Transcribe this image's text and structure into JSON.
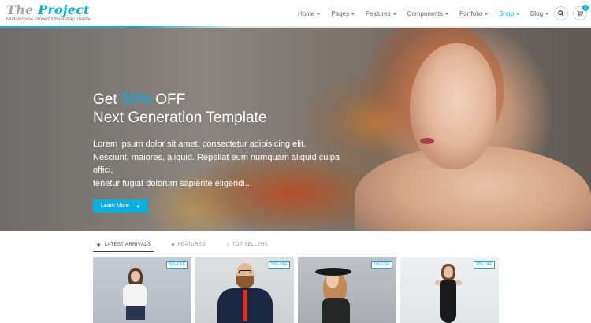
{
  "brand": {
    "logo_part1": "The",
    "logo_part2": "Project",
    "tagline": "Multipurpose Powerful Bootstrap Theme"
  },
  "nav": {
    "items": [
      {
        "label": "Home",
        "active": false
      },
      {
        "label": "Pages",
        "active": false
      },
      {
        "label": "Features",
        "active": false
      },
      {
        "label": "Components",
        "active": false
      },
      {
        "label": "Portfolio",
        "active": false
      },
      {
        "label": "Shop",
        "active": true
      },
      {
        "label": "Blog",
        "active": false
      }
    ],
    "search_icon": "search-icon",
    "cart_icon": "cart-icon",
    "cart_count": "0"
  },
  "hero": {
    "title_prefix": "Get",
    "title_accent": "50%",
    "title_suffix": "OFF",
    "title_line2": "Next Generation Template",
    "text_line1": "Lorem ipsum dolor sit amet, consectetur adipisicing elit.",
    "text_line2": "Nesciunt, maiores, aliquid. Repellat eum numquam aliquid culpa offici,",
    "text_line3": "tenetur fugiat dolorum sapiente eligendi...",
    "button_label": "Learn More"
  },
  "tabs": [
    {
      "label": "LATEST ARRIVALS",
      "icon": "star-icon",
      "active": true
    },
    {
      "label": "FEATURED",
      "icon": "heart-icon",
      "active": false
    },
    {
      "label": "TOP SELLERS",
      "icon": "arrow-up-icon",
      "active": false
    }
  ],
  "products": [
    {
      "discount": "30% OFF"
    },
    {
      "discount": "25% OFF"
    },
    {
      "discount": "33% OFF"
    },
    {
      "discount": "20% OFF"
    }
  ],
  "colors": {
    "accent": "#09afdf",
    "nav_text": "#666666"
  }
}
